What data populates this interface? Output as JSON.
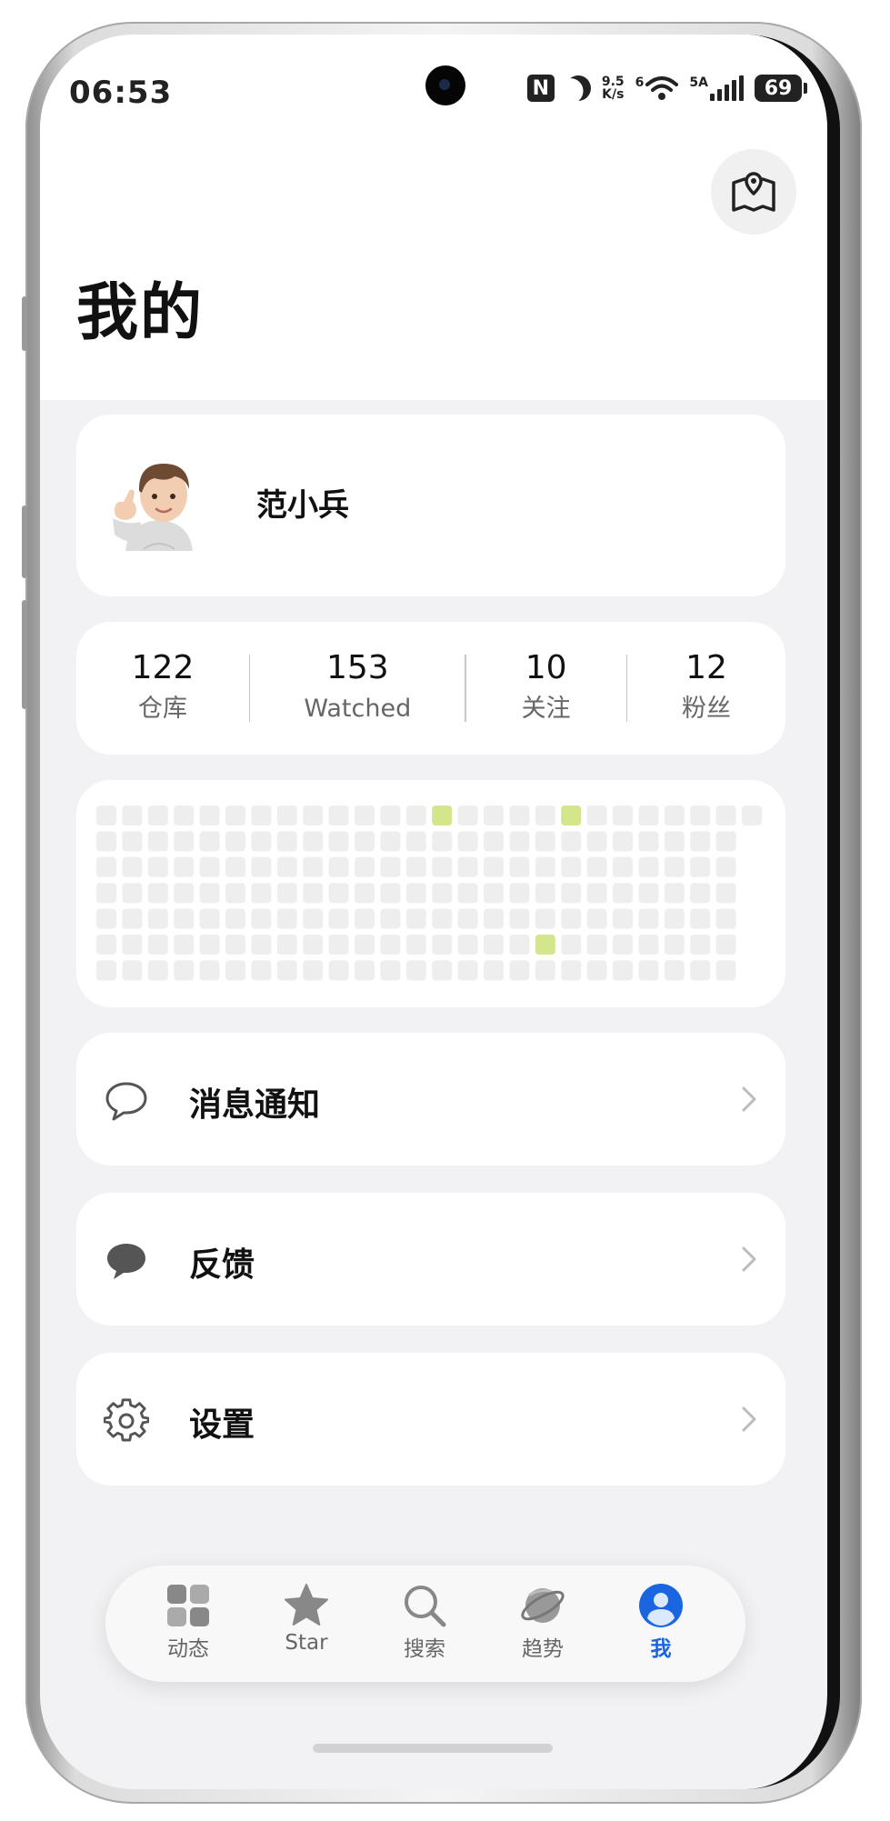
{
  "status_bar": {
    "time": "06:53",
    "nfc": "N",
    "net_speed_value": "9.5",
    "net_speed_unit": "K/s",
    "wifi_label": "6",
    "signal_label": "5A",
    "battery": "69"
  },
  "page": {
    "title": "我的"
  },
  "profile": {
    "name": "范小兵",
    "avatar_icon": "memoji-avatar-thumbs-up"
  },
  "stats": [
    {
      "value": "122",
      "label": "仓库"
    },
    {
      "value": "153",
      "label": "Watched"
    },
    {
      "value": "10",
      "label": "关注"
    },
    {
      "value": "12",
      "label": "粉丝"
    }
  ],
  "contributions": {
    "rows": 7,
    "cols": 26,
    "empty_color": "#eeeeee",
    "active_color": "#d4e68b",
    "active_cells": [
      [
        0,
        13
      ],
      [
        0,
        18
      ],
      [
        5,
        17
      ]
    ]
  },
  "menu": [
    {
      "label": "消息通知",
      "icon": "chat-bubble-outline-icon"
    },
    {
      "label": "反馈",
      "icon": "chat-bubble-filled-icon"
    },
    {
      "label": "设置",
      "icon": "gear-icon"
    }
  ],
  "tabbar": {
    "accent_color": "#1a66e0",
    "tabs": [
      {
        "label": "动态",
        "icon": "grid-icon",
        "active": false
      },
      {
        "label": "Star",
        "icon": "star-icon",
        "active": false
      },
      {
        "label": "搜索",
        "icon": "search-icon",
        "active": false
      },
      {
        "label": "趋势",
        "icon": "planet-icon",
        "active": false
      },
      {
        "label": "我",
        "icon": "person-icon",
        "active": true
      }
    ]
  }
}
